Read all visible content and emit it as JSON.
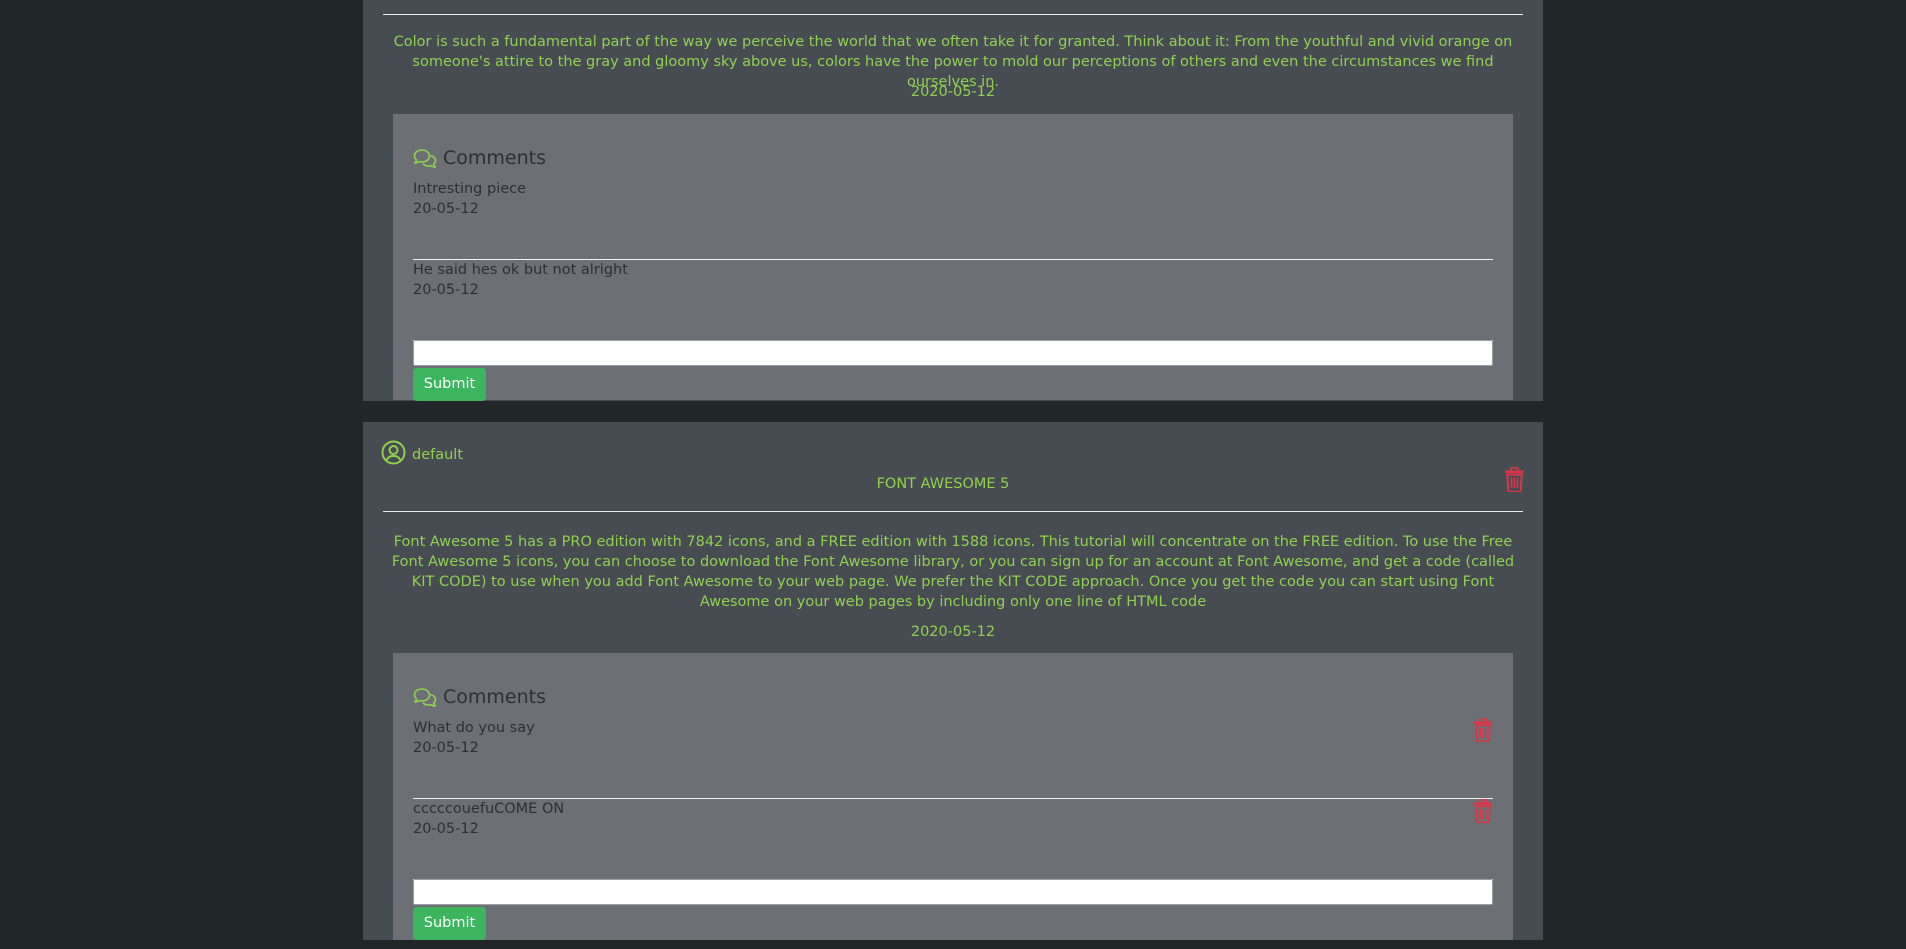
{
  "colors": {
    "page_background": "#212629",
    "post_background": "#474c52",
    "comments_background": "#6c7075",
    "accent_green": "#8fd14f",
    "submit_green": "#3cb55e",
    "delete_red": "#dc3545"
  },
  "posts": [
    {
      "body": "Color is such a fundamental part of the way we perceive the world that we often take it for granted. Think about it: From the youthful and vivid orange on someone's attire to the gray and gloomy sky above us, colors have the power to mold our perceptions of others and even the circumstances we find ourselves in.",
      "date": "2020-05-12",
      "comments_title": "Comments",
      "comments": [
        {
          "text": "Intresting piece",
          "date": "20-05-12"
        },
        {
          "text": "He said hes ok but not alright",
          "date": "20-05-12"
        }
      ],
      "comment_input_value": "",
      "submit_label": "Submit"
    },
    {
      "author": "default",
      "title": "FONT AWESOME 5",
      "body": "Font Awesome 5 has a PRO edition with 7842 icons, and a FREE edition with 1588 icons. This tutorial will concentrate on the FREE edition. To use the Free Font Awesome 5 icons, you can choose to download the Font Awesome library, or you can sign up for an account at Font Awesome, and get a code (called KIT CODE) to use when you add Font Awesome to your web page. We prefer the KIT CODE approach. Once you get the code you can start using Font Awesome on your web pages by including only one line of HTML code",
      "date": "2020-05-12",
      "comments_title": "Comments",
      "comments": [
        {
          "text": "What do you say",
          "date": "20-05-12"
        },
        {
          "text": "cccccouefuCOME ON",
          "date": "20-05-12"
        }
      ],
      "comment_input_value": "",
      "submit_label": "Submit"
    }
  ],
  "icons": {
    "comments": "comments-icon",
    "user": "user-circle-icon",
    "delete": "trash-icon"
  }
}
